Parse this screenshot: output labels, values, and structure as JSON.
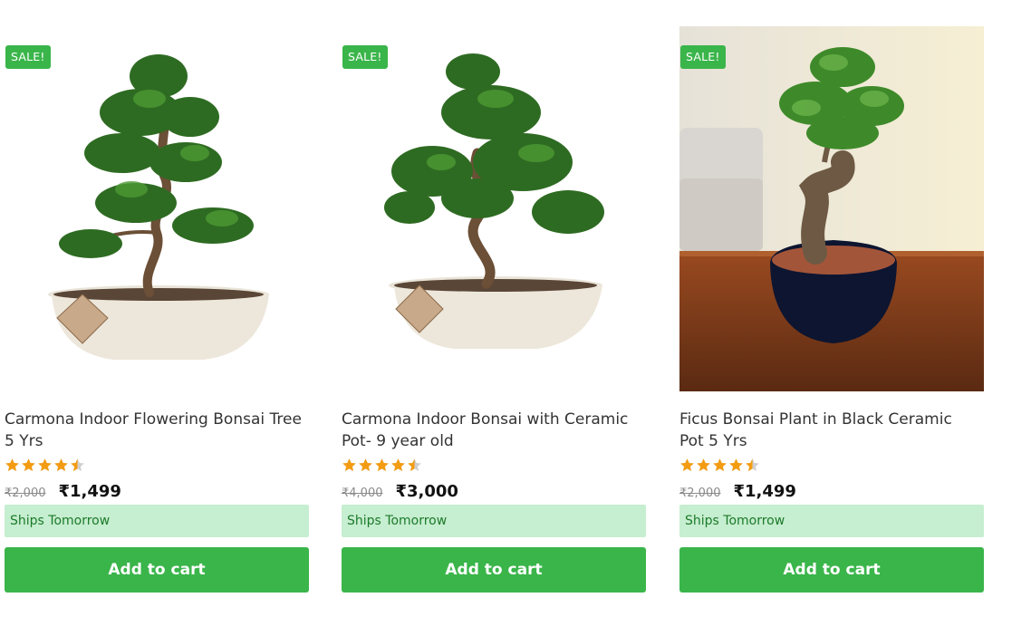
{
  "products": [
    {
      "badge": "SALE!",
      "title": "Carmona Indoor Flowering Bonsai Tree 5 Yrs",
      "rating": 4.5,
      "old_price": "₹2,000",
      "price": "₹1,499",
      "shipping": "Ships Tomorrow",
      "cta": "Add to cart",
      "image": "carmona-bonsai-cream-pot"
    },
    {
      "badge": "SALE!",
      "title": "Carmona Indoor Bonsai with Ceramic Pot- 9 year old",
      "rating": 4.5,
      "old_price": "₹4,000",
      "price": "₹3,000",
      "shipping": "Ships Tomorrow",
      "cta": "Add to cart",
      "image": "carmona-bonsai-s-trunk-cream-pot"
    },
    {
      "badge": "SALE!",
      "title": "Ficus Bonsai Plant in Black Ceramic Pot 5 Yrs",
      "rating": 4.5,
      "old_price": "₹2,000",
      "price": "₹1,499",
      "shipping": "Ships Tomorrow",
      "cta": "Add to cart",
      "image": "ficus-bonsai-black-pot-on-table"
    }
  ],
  "colors": {
    "accent": "#3ab54a",
    "ship_bg": "#c6eed0",
    "ship_text": "#1c7a2a",
    "star": "#f39c12",
    "star_empty": "#cfcfcf"
  }
}
